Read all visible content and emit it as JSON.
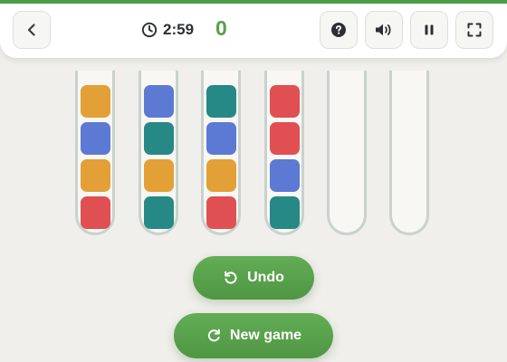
{
  "topbar": {
    "timer": "2:59",
    "score": "0",
    "progress": 1.0,
    "icons": {
      "back": "chevron-left-icon",
      "clock": "clock-icon",
      "help": "question-icon",
      "sound": "speaker-icon",
      "pause": "pause-icon",
      "fullscreen": "fullscreen-icon"
    }
  },
  "board": {
    "colors": {
      "orange": "#e3a037",
      "blue": "#5c7ad3",
      "teal": "#268985",
      "red": "#e05052"
    },
    "tubes": [
      [
        "orange",
        "blue",
        "orange",
        "red"
      ],
      [
        "blue",
        "teal",
        "orange",
        "teal"
      ],
      [
        "teal",
        "blue",
        "orange",
        "red"
      ],
      [
        "red",
        "red",
        "blue",
        "teal"
      ],
      [],
      []
    ]
  },
  "actions": {
    "undo_label": "Undo",
    "new_game_label": "New game"
  },
  "theme": {
    "accent": "#5a9e4a",
    "background": "#f0efeb"
  }
}
